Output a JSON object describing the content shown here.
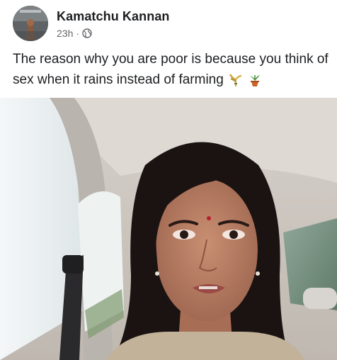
{
  "post": {
    "author": "Kamatchu Kannan",
    "timestamp": "23h",
    "separator": "·",
    "privacy_icon": "globe-icon",
    "text": "The reason why you are poor is because you think of sex when it rains instead of farming",
    "emojis": [
      "rice-sheaf-icon",
      "potted-plant-icon"
    ]
  },
  "colors": {
    "text_primary": "#1c1e21",
    "text_secondary": "#65676b"
  }
}
